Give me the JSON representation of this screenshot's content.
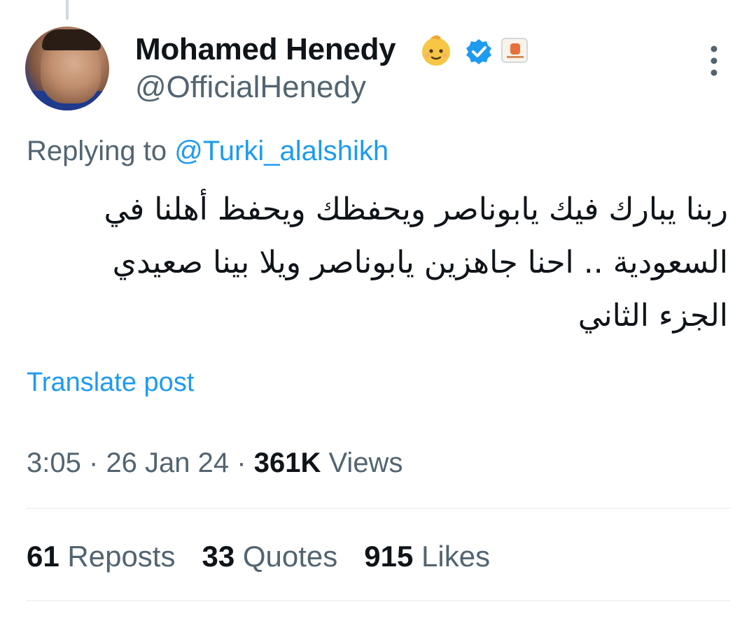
{
  "tweet": {
    "author": {
      "display_name": "Mohamed Henedy",
      "handle": "@OfficialHenedy",
      "badge_emoji": "baby-face-icon",
      "verified_icon": "verified-check-icon",
      "affiliate_icon": "affiliate-badge-icon"
    },
    "reply_prefix": "Replying to ",
    "reply_to": "@Turki_alalshikh",
    "text_lines": [
      "ربنا يبارك فيك يابوناصر ويحفظك ويحفظ أهلنا في",
      "السعودية .. احنا جاهزين يابوناصر ويلا بينا صعيدي",
      "الجزء الثاني"
    ],
    "translate_label": "Translate post",
    "time": "3:05",
    "date": "26 Jan 24",
    "separator": "·",
    "views_count": "361K",
    "views_label": "Views",
    "stats": {
      "reposts_count": "61",
      "reposts_label": "Reposts",
      "quotes_count": "33",
      "quotes_label": "Quotes",
      "likes_count": "915",
      "likes_label": "Likes"
    }
  },
  "colors": {
    "link": "#1d9bf0",
    "secondary_text": "#536471",
    "primary_text": "#0f1419",
    "divider": "#eff3f4"
  }
}
